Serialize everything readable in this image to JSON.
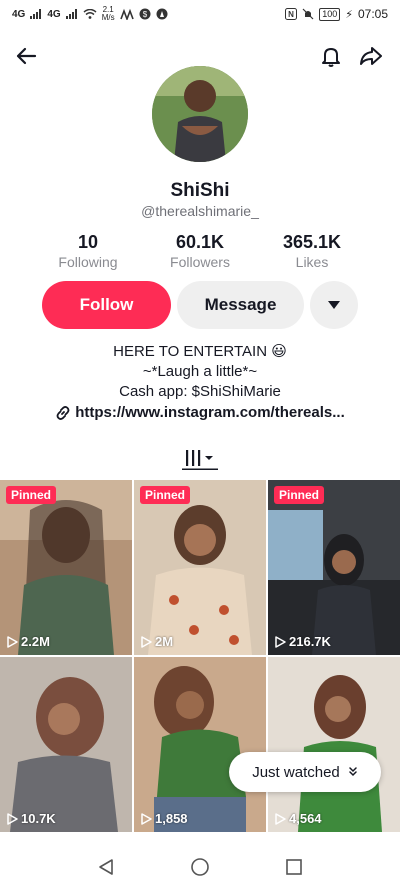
{
  "status_bar": {
    "signal1": "4G",
    "signal2": "4G",
    "net_speed_value": "2.1",
    "net_speed_unit": "M/s",
    "battery": "100",
    "time": "07:05"
  },
  "profile": {
    "name": "ShiShi",
    "handle": "@therealshimarie_",
    "stats": [
      {
        "value": "10",
        "label": "Following"
      },
      {
        "value": "60.1K",
        "label": "Followers"
      },
      {
        "value": "365.1K",
        "label": "Likes"
      }
    ],
    "follow_label": "Follow",
    "message_label": "Message",
    "bio_lines": [
      "HERE TO ENTERTAIN 😃",
      "~*Laugh a little*~",
      "Cash app: $ShiShiMarie"
    ],
    "link": "https://www.instagram.com/thereals..."
  },
  "videos": [
    {
      "pinned_label": "Pinned",
      "views": "2.2M"
    },
    {
      "pinned_label": "Pinned",
      "views": "2M"
    },
    {
      "pinned_label": "Pinned",
      "views": "216.7K"
    },
    {
      "pinned_label": "",
      "views": "10.7K"
    },
    {
      "pinned_label": "",
      "views": "1,858"
    },
    {
      "pinned_label": "",
      "views": "4,564"
    }
  ],
  "just_watched_label": "Just watched",
  "colors": {
    "accent": "#fe2c55",
    "secondary_bg": "#efefef"
  }
}
